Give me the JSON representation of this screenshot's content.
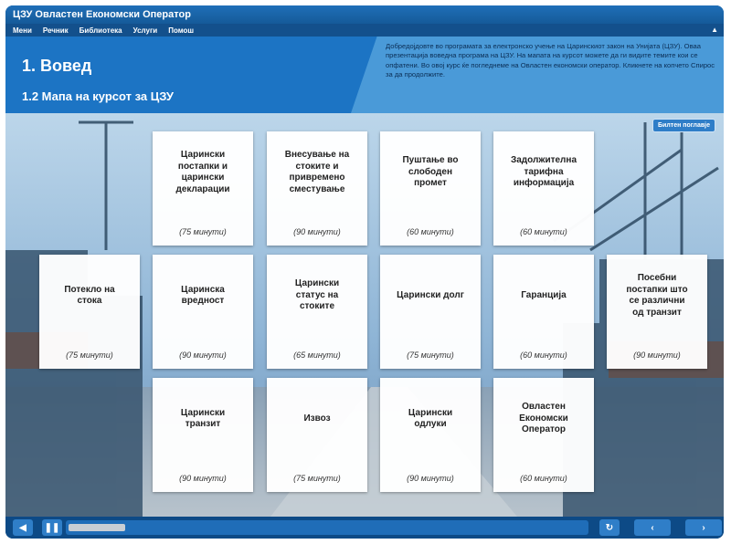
{
  "window": {
    "title": "ЦЗУ Овластен Економски Оператор"
  },
  "menu": {
    "items": [
      "Мени",
      "Речник",
      "Библиотека",
      "Услуги",
      "Помош"
    ]
  },
  "header": {
    "section": "1. Вовед",
    "subtitle": "1.2 Мапа на курсот за ЦЗУ",
    "intro": "Добредојдовте во програмата за електронско учење на Царинскиот закон на Унијата (ЦЗУ). Оваа презентација вовед­на програма на ЦЗУ. На мапата на курсот можете да ги видите темите кои се опфатени. Во овој курс ќе погледнеме на Овластен економски оператор. Кликнете на копчето Спирос за да продолжите."
  },
  "glossary_button": "Билтен поглавје",
  "cards": [
    {
      "title": "Царински\nпостапки и\nцарински\nдекларации",
      "duration": "(75 минути)"
    },
    {
      "title": "Внесување на\nстоките и\nпривремено\nсместување",
      "duration": "(90 минути)"
    },
    {
      "title": "Пуштање во\nслободен\nпромет",
      "duration": "(60 минути)"
    },
    {
      "title": "Задолжителна\nтарифна\nинформација",
      "duration": "(60 минути)"
    },
    {
      "title": "Потекло на\nстока",
      "duration": "(75 минути)"
    },
    {
      "title": "Царинска\nвредност",
      "duration": "(90 минути)"
    },
    {
      "title": "Царински\nстатус на\nстоките",
      "duration": "(65 минути)"
    },
    {
      "title": "Царински долг",
      "duration": "(75 минути)"
    },
    {
      "title": "Гаранција",
      "duration": "(60 минути)"
    },
    {
      "title": "Посебни\nпостапки што\nсе различни\nод транзит",
      "duration": "(90 минути)"
    },
    {
      "title": "Царински\nтранзит",
      "duration": "(90 минути)"
    },
    {
      "title": "Извоз",
      "duration": "(75 минути)"
    },
    {
      "title": "Царински\nодлуки",
      "duration": "(90 минути)"
    },
    {
      "title": "Овластен\nЕкономски\nОператор",
      "duration": "(60 минути)"
    }
  ],
  "player": {
    "progress_fraction": 0.11
  },
  "colors": {
    "accent": "#1c74c4",
    "header_panel": "#4a9ad8",
    "bar": "#0d4a86"
  }
}
